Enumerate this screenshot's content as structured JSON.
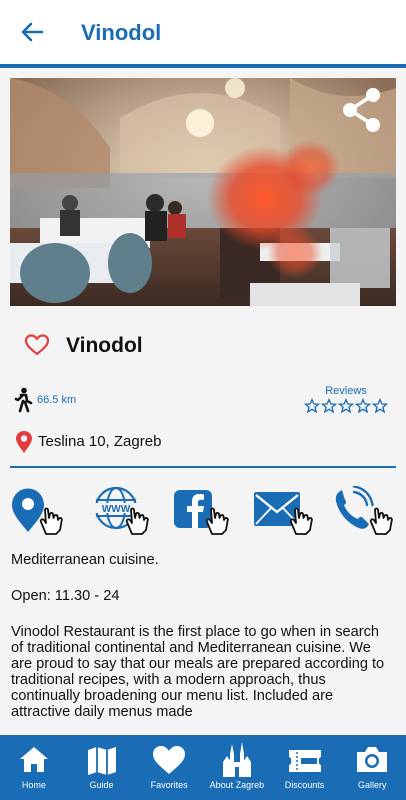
{
  "header": {
    "title": "Vinodol",
    "back_icon": "arrow-left-icon"
  },
  "colors": {
    "accent": "#1a6db5",
    "heart": "#e23c3c",
    "pin": "#e23c3c"
  },
  "place": {
    "name": "Vinodol",
    "distance": "66.5 km",
    "reviews_label": "Reviews",
    "rating_stars_filled": 0,
    "rating_stars_total": 5,
    "address": "Teslina 10, Zagreb"
  },
  "actions": [
    {
      "name": "map-location"
    },
    {
      "name": "website"
    },
    {
      "name": "facebook"
    },
    {
      "name": "email"
    },
    {
      "name": "phone"
    }
  ],
  "description": {
    "cuisine": "Mediterranean cuisine.",
    "hours": "Open: 11.30 - 24",
    "text": "Vinodol Restaurant is the first place to go when in search of traditional continental and Mediterranean cuisine. We are proud to say that our meals are prepared according to traditional recipes, with a modern approach, thus continually broadening our menu list. Included are attractive daily menus made"
  },
  "tabs": [
    {
      "label": "Home"
    },
    {
      "label": "Guide"
    },
    {
      "label": "Favorites"
    },
    {
      "label": "About Zagreb"
    },
    {
      "label": "Discounts"
    },
    {
      "label": "Gallery"
    }
  ]
}
